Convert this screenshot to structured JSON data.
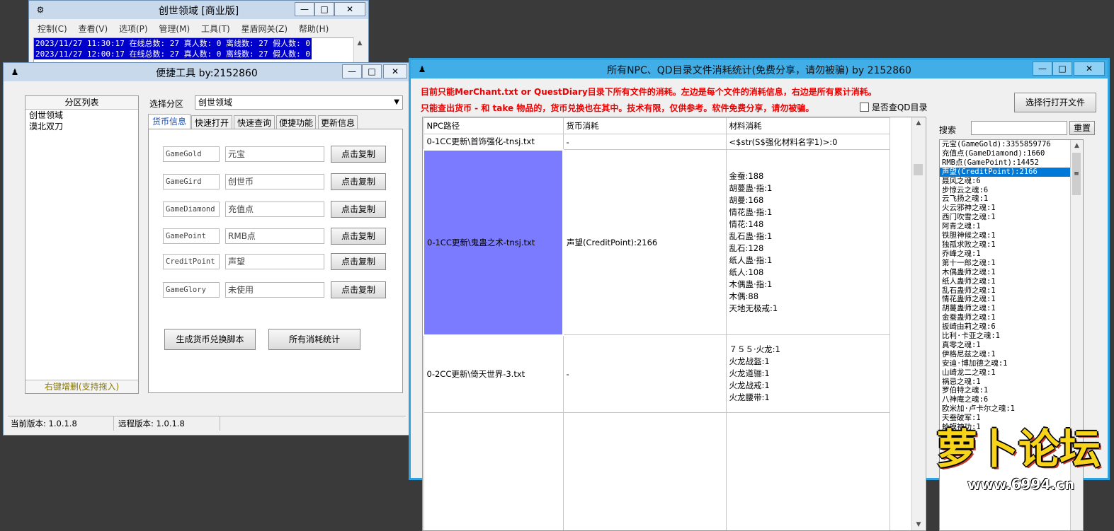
{
  "main_window": {
    "title": "创世领域 [商业版]",
    "menu": [
      "控制(C)",
      "查看(V)",
      "选项(P)",
      "管理(M)",
      "工具(T)",
      "星盾网关(Z)",
      "帮助(H)"
    ],
    "log_lines": [
      "2023/11/27 11:30:17 在线总数: 27 真人数: 0 离线数: 27 假人数: 0",
      "2023/11/27 12:00:17 在线总数: 27 真人数: 0 离线数: 27 假人数: 0"
    ]
  },
  "tool_window": {
    "title": "便捷工具  by:2152860",
    "partition_list": {
      "header": "分区列表",
      "items": [
        "创世领域",
        "漠北双刀"
      ],
      "footer": "右键增删(支持拖入)"
    },
    "select_label": "选择分区",
    "select_value": "创世领域",
    "tabs": [
      "货币信息",
      "快速打开",
      "快速查询",
      "便捷功能",
      "更新信息"
    ],
    "currency_rows": [
      {
        "code": "GameGold",
        "name": "元宝",
        "button": "点击复制"
      },
      {
        "code": "GameGird",
        "name": "创世币",
        "button": "点击复制"
      },
      {
        "code": "GameDiamond",
        "name": "充值点",
        "button": "点击复制"
      },
      {
        "code": "GamePoint",
        "name": "RMB点",
        "button": "点击复制"
      },
      {
        "code": "CreditPoint",
        "name": "声望",
        "button": "点击复制"
      },
      {
        "code": "GameGlory",
        "name": "未使用",
        "button": "点击复制"
      }
    ],
    "gen_script_button": "生成货币兑换脚本",
    "all_stats_button": "所有消耗统计",
    "status": {
      "current": "当前版本: 1.0.1.8",
      "remote": "远程版本: 1.0.1.8"
    }
  },
  "stats_window": {
    "title": "所有NPC、QD目录文件消耗统计(免费分享，请勿被骗)    by 2152860",
    "note1": "目前只能MerChant.txt or QuestDiary目录下所有文件的消耗。左边是每个文件的消耗信息，右边是所有累计消耗。",
    "note2": "只能查出货币 - 和 take 物品的，货币兑换也在其中。技术有限，仅供参考。软件免费分享，请勿被骗。",
    "checkbox_label": "是否查QD目录",
    "open_file_button": "选择行打开文件",
    "search_label": "搜索",
    "reset_button": "重置",
    "columns": [
      "NPC路径",
      "货币消耗",
      "材料消耗"
    ],
    "rows": [
      {
        "path": "0-1CC更新\\首饰强化-tnsj.txt",
        "currency": "-",
        "materials": [
          "<$str(S$强化材料名字1)>:0"
        ]
      },
      {
        "path": "0-1CC更新\\鬼蛊之术-tnsj.txt",
        "currency": "声望(CreditPoint):2166",
        "materials": [
          "金蚕:188",
          "胡蔓蛊·指:1",
          "胡曼:168",
          "情花蛊·指:1",
          "情花:148",
          "乱石蛊·指:1",
          "乱石:128",
          "纸人蛊·指:1",
          "纸人:108",
          "木偶蛊·指:1",
          "木偶:88",
          "天地无极戒:1"
        ]
      },
      {
        "path": "0-2CC更新\\倚天世界-3.txt",
        "currency": "-",
        "materials": [
          "７５５·火龙:1",
          "火龙战盔:1",
          "火龙道骊:1",
          "火龙战戒:1",
          "火龙腰带:1"
        ]
      },
      {
        "path": "",
        "currency": "",
        "materials": []
      }
    ],
    "summary": [
      "元宝(GameGold):3355859776",
      "充值点(GameDiamond):1660",
      "RMB点(GamePoint):14452",
      "声望(CreditPoint):2166",
      "聂风之魂:6",
      "步惊云之魂:6",
      "云飞扬之魂:1",
      "火云邪神之魂:1",
      "西门吹雪之魂:1",
      "阿青之魂:1",
      "铁胆神候之魂:1",
      "独孤求败之魂:1",
      "乔峰之魂:1",
      "第十一郎之魂:1",
      "木偶蛊师之魂:1",
      "纸人蛊师之魂:1",
      "乱石蛊师之魂:1",
      "情花蛊师之魂:1",
      "胡蔓蛊师之魂:1",
      "金蚕蛊师之魂:1",
      "扳崎由莉之魂:6",
      "比利·卡亚之魂:1",
      "真零之魂:1",
      "伊格尼兹之魂:1",
      "安迪·博加德之魂:1",
      "山崎龙二之魂:1",
      "祸忌之魂:1",
      "罗伯特之魂:1",
      "八神庵之魂:6",
      "欧米加·卢卡尔之魂:1",
      "天蚕破军:1",
      "蛤蟆神功:1",
      "莲:1"
    ],
    "selected_summary_index": 3
  },
  "watermark": {
    "text": "萝卜论坛",
    "url": "www.6994.cn"
  },
  "colors": {
    "selection_blue": "#0078d7",
    "highlight_cell": "#7b7bff",
    "note_red": "#e00000",
    "log_bg": "#0000cd"
  }
}
